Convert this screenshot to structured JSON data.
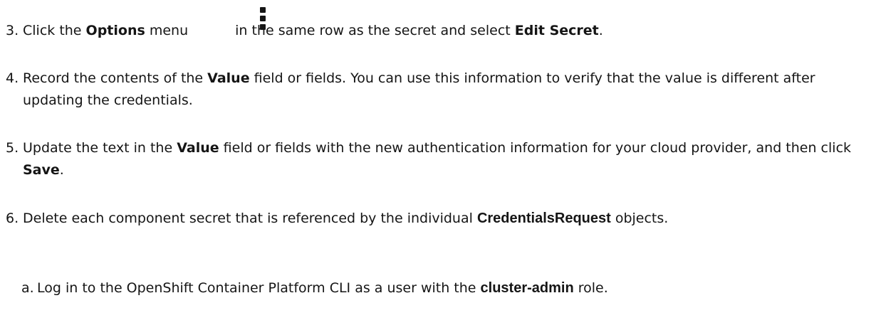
{
  "steps": [
    {
      "number": "3.",
      "parts": {
        "t1": "Click the ",
        "b1": "Options",
        "t2": " menu",
        "t3": "in the same row as the secret and select ",
        "b2": "Edit Secret",
        "t4": "."
      },
      "icon": "kebab-menu-icon"
    },
    {
      "number": "4.",
      "parts": {
        "t1": "Record the contents of the ",
        "b1": "Value",
        "t2": " field or fields. You can use this information to verify that the value is different after updating the credentials."
      }
    },
    {
      "number": "5.",
      "parts": {
        "t1": "Update the text in the ",
        "b1": "Value",
        "t2": " field or fields with the new authentication information for your cloud provider, and then click ",
        "b2": "Save",
        "t3": "."
      }
    },
    {
      "number": "6.",
      "parts": {
        "t1": "Delete each component secret that is referenced by the individual ",
        "b1": "CredentialsRequest",
        "t2": " objects."
      }
    }
  ],
  "substeps": [
    {
      "number": "a.",
      "parts": {
        "t1": "Log in to the OpenShift Container Platform CLI as a user with the ",
        "b1": "cluster-admin",
        "t2": " role."
      }
    }
  ]
}
